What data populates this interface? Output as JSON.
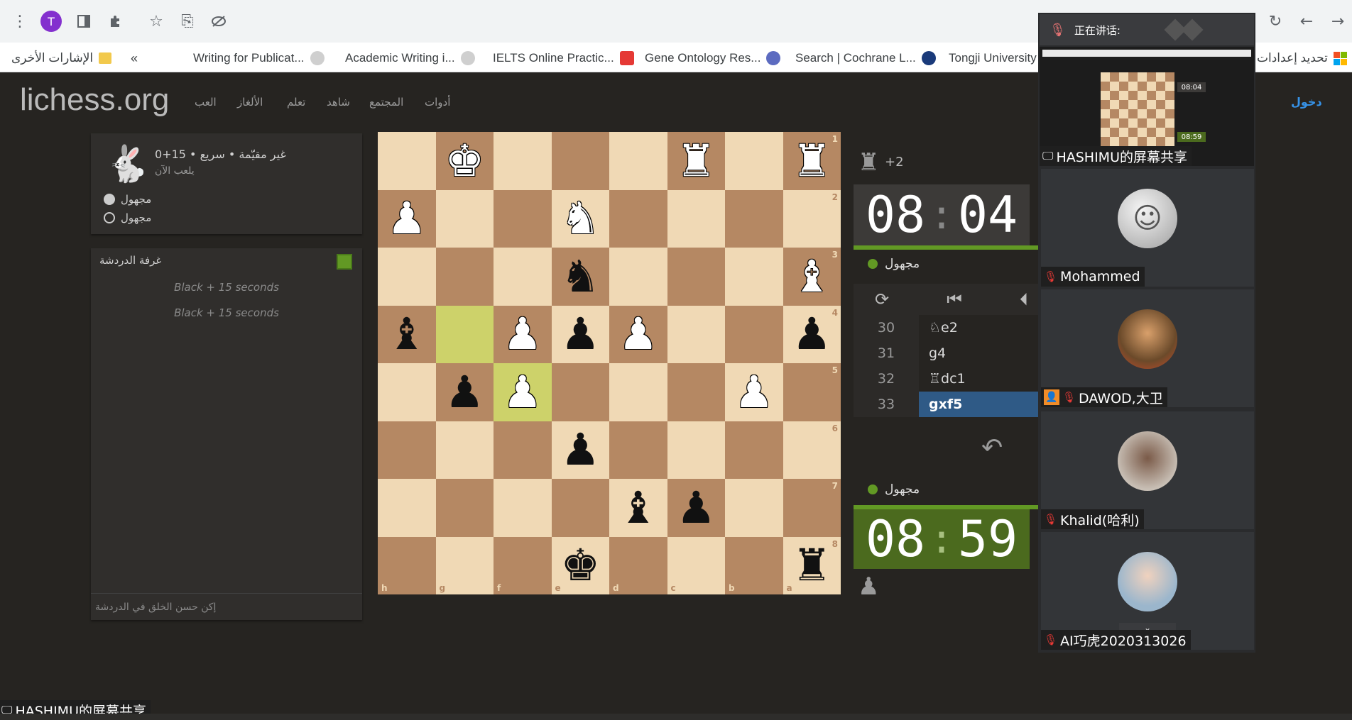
{
  "browser": {
    "profile_initial": "T",
    "bookmarks_overflow": "«",
    "other_bookmarks": "الإشارات الأخرى",
    "bookmarks": [
      {
        "label": "Writing for Publicat..."
      },
      {
        "label": "Academic Writing i..."
      },
      {
        "label": "IELTS Online Practic..."
      },
      {
        "label": "Gene Ontology Res..."
      },
      {
        "label": "Search | Cochrane L..."
      },
      {
        "label": "Tongji University"
      }
    ],
    "update_settings": "تحديد إعدادات"
  },
  "site": {
    "logo": "lichess.org",
    "nav": [
      "العب",
      "الألغاز",
      "تعلم",
      "شاهد",
      "المجتمع",
      "أدوات"
    ],
    "signin": "دخول"
  },
  "game_info": {
    "setup": "غير مقيّمة • سريع • 15+0",
    "status": "يلعب الآن",
    "players": [
      "مجهول",
      "مجهول"
    ]
  },
  "chat": {
    "title": "غرفة الدردشة",
    "messages": [
      "Black + 15 seconds",
      "Black + 15 seconds"
    ],
    "placeholder": "إكن حسن الخلق في الدردشة"
  },
  "board": {
    "ranks": [
      "1",
      "2",
      "3",
      "4",
      "5",
      "6",
      "7",
      "8"
    ],
    "files": [
      "h",
      "g",
      "f",
      "e",
      "d",
      "c",
      "b",
      "a"
    ],
    "rows": [
      [
        "",
        "wK",
        "",
        "",
        "",
        "wR",
        "",
        "wR"
      ],
      [
        "wP",
        "",
        "",
        "wN",
        "",
        "",
        "",
        ""
      ],
      [
        "",
        "",
        "",
        "bN",
        "",
        "",
        "",
        "wB"
      ],
      [
        "bB",
        "",
        "wP",
        "bP",
        "wP",
        "",
        "",
        "bP"
      ],
      [
        "",
        "bP",
        "wP",
        "",
        "",
        "",
        "wP",
        ""
      ],
      [
        "",
        "",
        "",
        "bP",
        "",
        "",
        "",
        ""
      ],
      [
        "",
        "",
        "",
        "",
        "bB",
        "bP",
        "",
        ""
      ],
      [
        "",
        "",
        "",
        "bK",
        "",
        "",
        "",
        "bR"
      ]
    ],
    "last_move": [
      "g4",
      "f5"
    ]
  },
  "clocks": {
    "top": {
      "material": "+2",
      "time_min": "08",
      "time_sec": "04",
      "player": "مجهول"
    },
    "bottom": {
      "time_min": "08",
      "time_sec": "59",
      "player": "مجهول"
    }
  },
  "moves": [
    {
      "num": "30",
      "san": "♘e2"
    },
    {
      "num": "31",
      "san": "g4"
    },
    {
      "num": "32",
      "san": "♖dc1"
    },
    {
      "num": "33",
      "san": "gxf5"
    }
  ],
  "meeting": {
    "speaking_label": "正在讲话:",
    "share_label": "HASHIMU的屏幕共享",
    "participants": [
      {
        "name": "Mohammed"
      },
      {
        "name": "DAWOD,大卫"
      },
      {
        "name": "Khalid(哈利)"
      },
      {
        "name": "AI巧虎2020313026"
      }
    ],
    "preview_clock_top": "08:04",
    "preview_clock_bottom": "08:59",
    "bottom_share_label": "HASHIMU的屏幕共享"
  }
}
